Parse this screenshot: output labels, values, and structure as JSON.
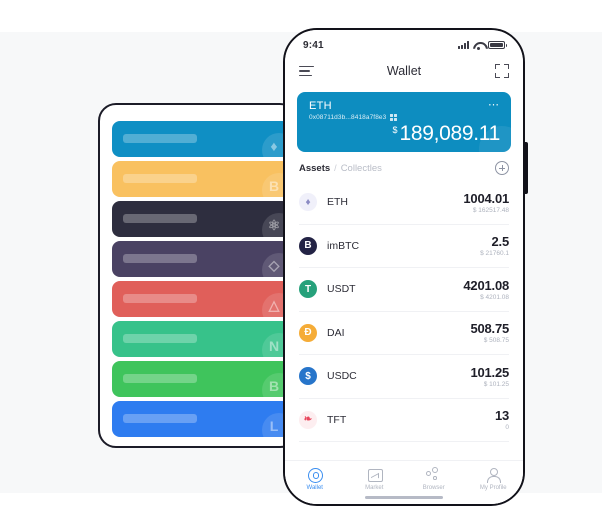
{
  "background": {
    "top_band_color": "#ffffff",
    "middle_band_color": "#f7f8f9",
    "bottom_band_color": "#ffffff"
  },
  "left_panel": {
    "name": "wallet-card-stack",
    "cards": [
      {
        "token": "ETH",
        "glyph": "♦",
        "color": "#0f8fc4"
      },
      {
        "token": "BTC",
        "glyph": "B",
        "color": "#f9c160"
      },
      {
        "token": "ATOM",
        "glyph": "⚛",
        "color": "#2e2e3f"
      },
      {
        "token": "EOS",
        "glyph": "◇",
        "color": "#4a4263"
      },
      {
        "token": "TRX",
        "glyph": "△",
        "color": "#e05f5a"
      },
      {
        "token": "NANO",
        "glyph": "N",
        "color": "#37c28a"
      },
      {
        "token": "BCH",
        "glyph": "B",
        "color": "#3fc45c"
      },
      {
        "token": "LTC",
        "glyph": "L",
        "color": "#2e7cf0"
      }
    ]
  },
  "phone": {
    "status_bar": {
      "time": "9:41",
      "signal_icon": "cellular-signal-icon",
      "wifi_icon": "wifi-icon",
      "battery_icon": "battery-icon"
    },
    "nav": {
      "menu_icon": "hamburger-menu-icon",
      "title": "Wallet",
      "scan_icon": "scan-qr-icon"
    },
    "balance_card": {
      "wallet_name": "ETH",
      "address": "0x08711d3b...8418a7f8e3",
      "qr_icon": "qr-code-icon",
      "more_icon": "more-options-icon",
      "currency_symbol": "$",
      "amount": "189,089.11",
      "accent_color": "#0d8dc0"
    },
    "assets_header": {
      "tab_active": "Assets",
      "separator": "/",
      "tab_inactive": "Collectles",
      "add_icon": "plus-circle-icon"
    },
    "assets": [
      {
        "symbol": "ETH",
        "icon_glyph": "♦",
        "icon_color": "#f0f0fa",
        "icon_text_color": "#8c8cc4",
        "amount": "1004.01",
        "fiat": "$ 162517.48"
      },
      {
        "symbol": "imBTC",
        "icon_glyph": "B",
        "icon_color": "#232345",
        "icon_text_color": "#ffffff",
        "amount": "2.5",
        "fiat": "$ 21760.1"
      },
      {
        "symbol": "USDT",
        "icon_glyph": "T",
        "icon_color": "#26a17b",
        "icon_text_color": "#ffffff",
        "amount": "4201.08",
        "fiat": "$ 4201.08"
      },
      {
        "symbol": "DAI",
        "icon_glyph": "Đ",
        "icon_color": "#f5ac37",
        "icon_text_color": "#ffffff",
        "amount": "508.75",
        "fiat": "$ 508.75"
      },
      {
        "symbol": "USDC",
        "icon_glyph": "$",
        "icon_color": "#2775ca",
        "icon_text_color": "#ffffff",
        "amount": "101.25",
        "fiat": "$ 101.25"
      },
      {
        "symbol": "TFT",
        "icon_glyph": "❧",
        "icon_color": "#fdeef0",
        "icon_text_color": "#e8455b",
        "amount": "13",
        "fiat": "0"
      }
    ],
    "tabbar": {
      "items": [
        {
          "label": "Wallet",
          "icon": "wallet-icon",
          "active": true
        },
        {
          "label": "Market",
          "icon": "market-icon",
          "active": false
        },
        {
          "label": "Browser",
          "icon": "browser-icon",
          "active": false
        },
        {
          "label": "My Profile",
          "icon": "profile-icon",
          "active": false
        }
      ],
      "active_color": "#3a8ef0",
      "inactive_color": "#b0b5c0"
    },
    "home_indicator": "home-indicator"
  }
}
